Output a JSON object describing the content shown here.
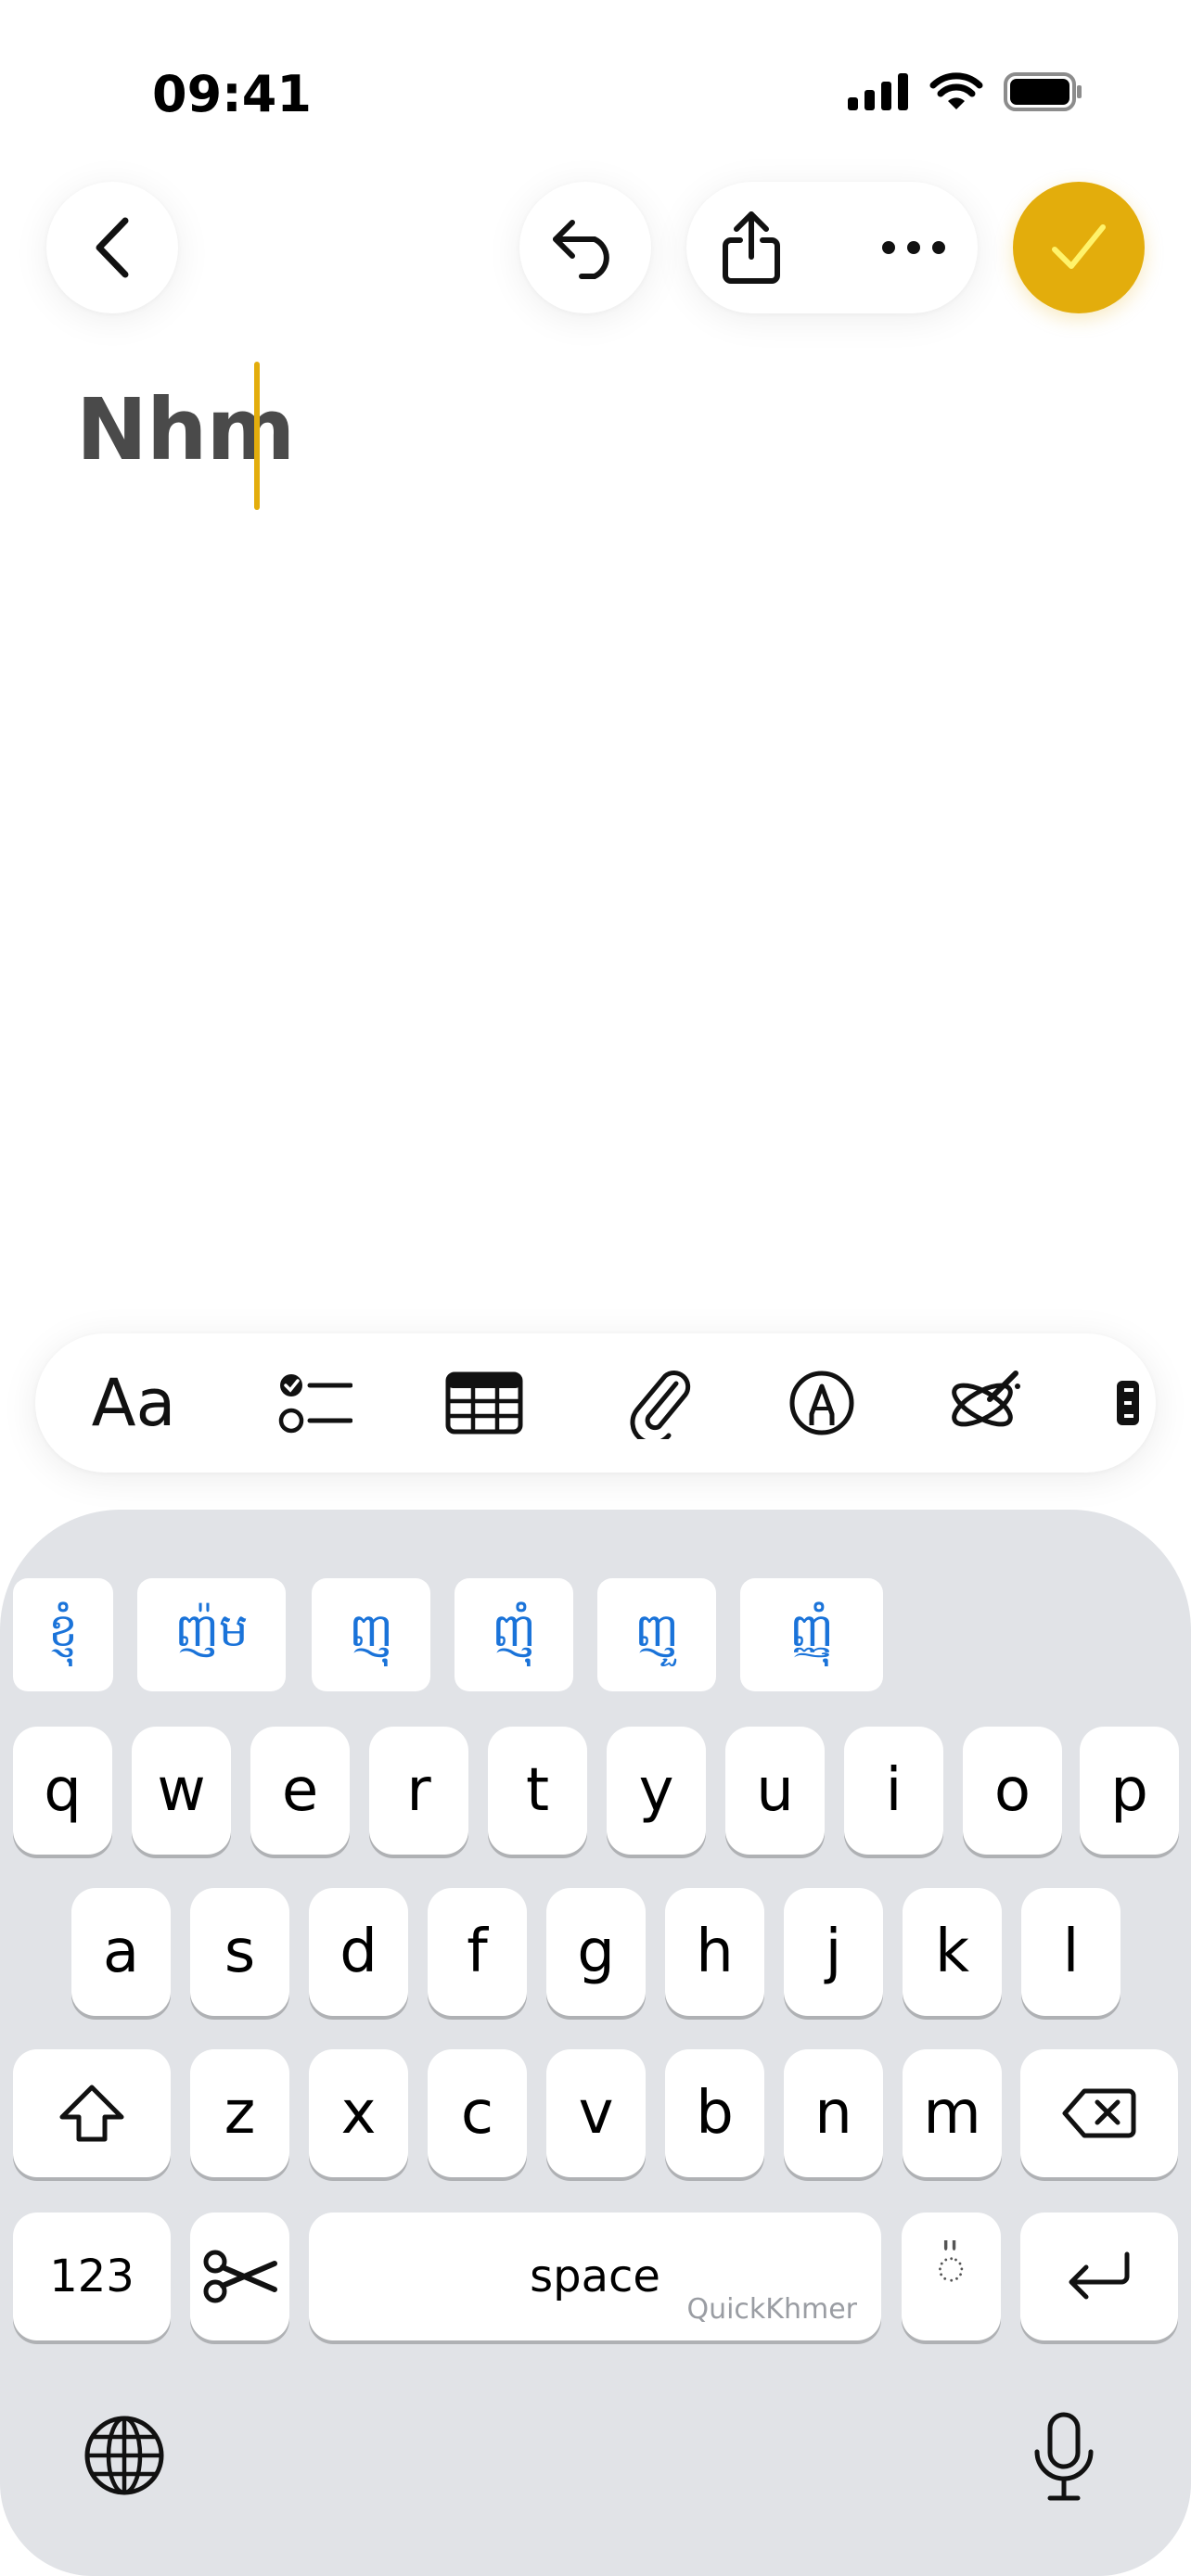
{
  "status_bar": {
    "time": "09:41"
  },
  "note": {
    "title": "Nhm"
  },
  "toolbar": {
    "back_icon": "chevron-left-icon",
    "undo_icon": "undo-icon",
    "share_icon": "share-icon",
    "more_icon": "ellipsis-icon",
    "done_icon": "checkmark-icon",
    "accent_color": "#E3AD0C"
  },
  "format_bar": {
    "text_style_label": "Aa",
    "items": [
      "checklist-icon",
      "table-icon",
      "attachment-icon",
      "markup-icon",
      "writing-tools-icon"
    ]
  },
  "keyboard": {
    "suggestions": [
      "ខ្ញុំ",
      "ញ៉ម",
      "ញុ",
      "ញុំ",
      "ញួ",
      "ញ្ញុំ"
    ],
    "row1": [
      "q",
      "w",
      "e",
      "r",
      "t",
      "y",
      "u",
      "i",
      "o",
      "p"
    ],
    "row2": [
      "a",
      "s",
      "d",
      "f",
      "g",
      "h",
      "j",
      "k",
      "l"
    ],
    "row3": [
      "z",
      "x",
      "c",
      "v",
      "b",
      "n",
      "m"
    ],
    "numbers_label": "123",
    "space_label": "space",
    "space_brand": "QuickKhmer",
    "khmer_key": "៉",
    "shift_icon": "shift-icon",
    "delete_icon": "delete-icon",
    "return_icon": "return-icon",
    "cut_icon": "scissors-icon",
    "globe_icon": "globe-icon",
    "mic_icon": "microphone-icon"
  }
}
